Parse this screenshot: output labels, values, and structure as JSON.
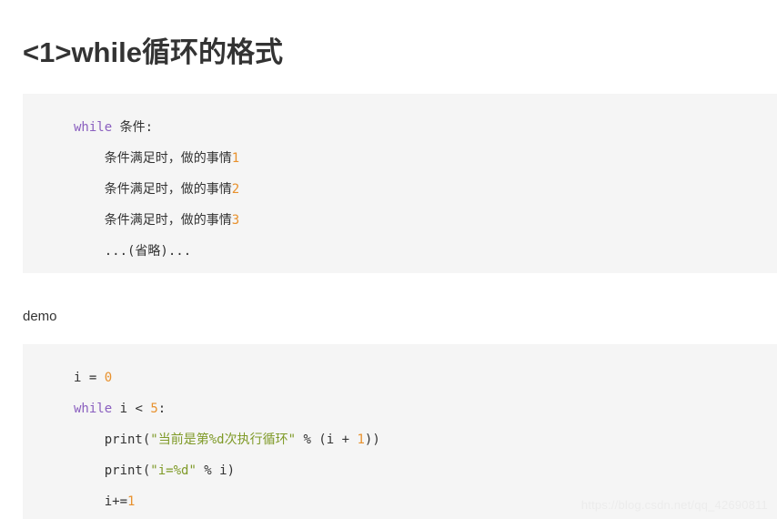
{
  "page": {
    "title": "<1>while循环的格式",
    "demo_label": "demo",
    "watermark": "https://blog.csdn.net/qq_42690811",
    "colors": {
      "background": "#ffffff",
      "code_background": "#f5f5f5",
      "text": "#333333",
      "keyword": "#8a5fbf",
      "number": "#e8912d",
      "string": "#7f9a28",
      "watermark": "#ececec"
    }
  },
  "code_blocks": [
    {
      "id": "code-block-1",
      "lines": [
        {
          "indent": "",
          "tokens": [
            {
              "text": "while",
              "type": "kw"
            },
            {
              "text": " 条件:",
              "type": "plain"
            }
          ]
        },
        {
          "indent": "    ",
          "tokens": [
            {
              "text": "条件满足时，做的事情",
              "type": "plain"
            },
            {
              "text": "1",
              "type": "num"
            }
          ]
        },
        {
          "indent": "    ",
          "tokens": [
            {
              "text": "条件满足时，做的事情",
              "type": "plain"
            },
            {
              "text": "2",
              "type": "num"
            }
          ]
        },
        {
          "indent": "    ",
          "tokens": [
            {
              "text": "条件满足时，做的事情",
              "type": "plain"
            },
            {
              "text": "3",
              "type": "num"
            }
          ]
        },
        {
          "indent": "    ",
          "tokens": [
            {
              "text": "...(省略)...",
              "type": "plain"
            }
          ]
        }
      ]
    },
    {
      "id": "code-block-2",
      "lines": [
        {
          "indent": "",
          "tokens": [
            {
              "text": "i = ",
              "type": "plain"
            },
            {
              "text": "0",
              "type": "num"
            }
          ]
        },
        {
          "indent": "",
          "tokens": [
            {
              "text": "while",
              "type": "kw"
            },
            {
              "text": " i < ",
              "type": "plain"
            },
            {
              "text": "5",
              "type": "num"
            },
            {
              "text": ":",
              "type": "plain"
            }
          ]
        },
        {
          "indent": "    ",
          "tokens": [
            {
              "text": "print(",
              "type": "plain"
            },
            {
              "text": "\"当前是第%d次执行循环\"",
              "type": "str"
            },
            {
              "text": " % (i + ",
              "type": "plain"
            },
            {
              "text": "1",
              "type": "num"
            },
            {
              "text": "))",
              "type": "plain"
            }
          ]
        },
        {
          "indent": "    ",
          "tokens": [
            {
              "text": "print(",
              "type": "plain"
            },
            {
              "text": "\"i=%d\"",
              "type": "str"
            },
            {
              "text": " % i)",
              "type": "plain"
            }
          ]
        },
        {
          "indent": "    ",
          "tokens": [
            {
              "text": "i+=",
              "type": "plain"
            },
            {
              "text": "1",
              "type": "num"
            }
          ]
        }
      ]
    }
  ]
}
